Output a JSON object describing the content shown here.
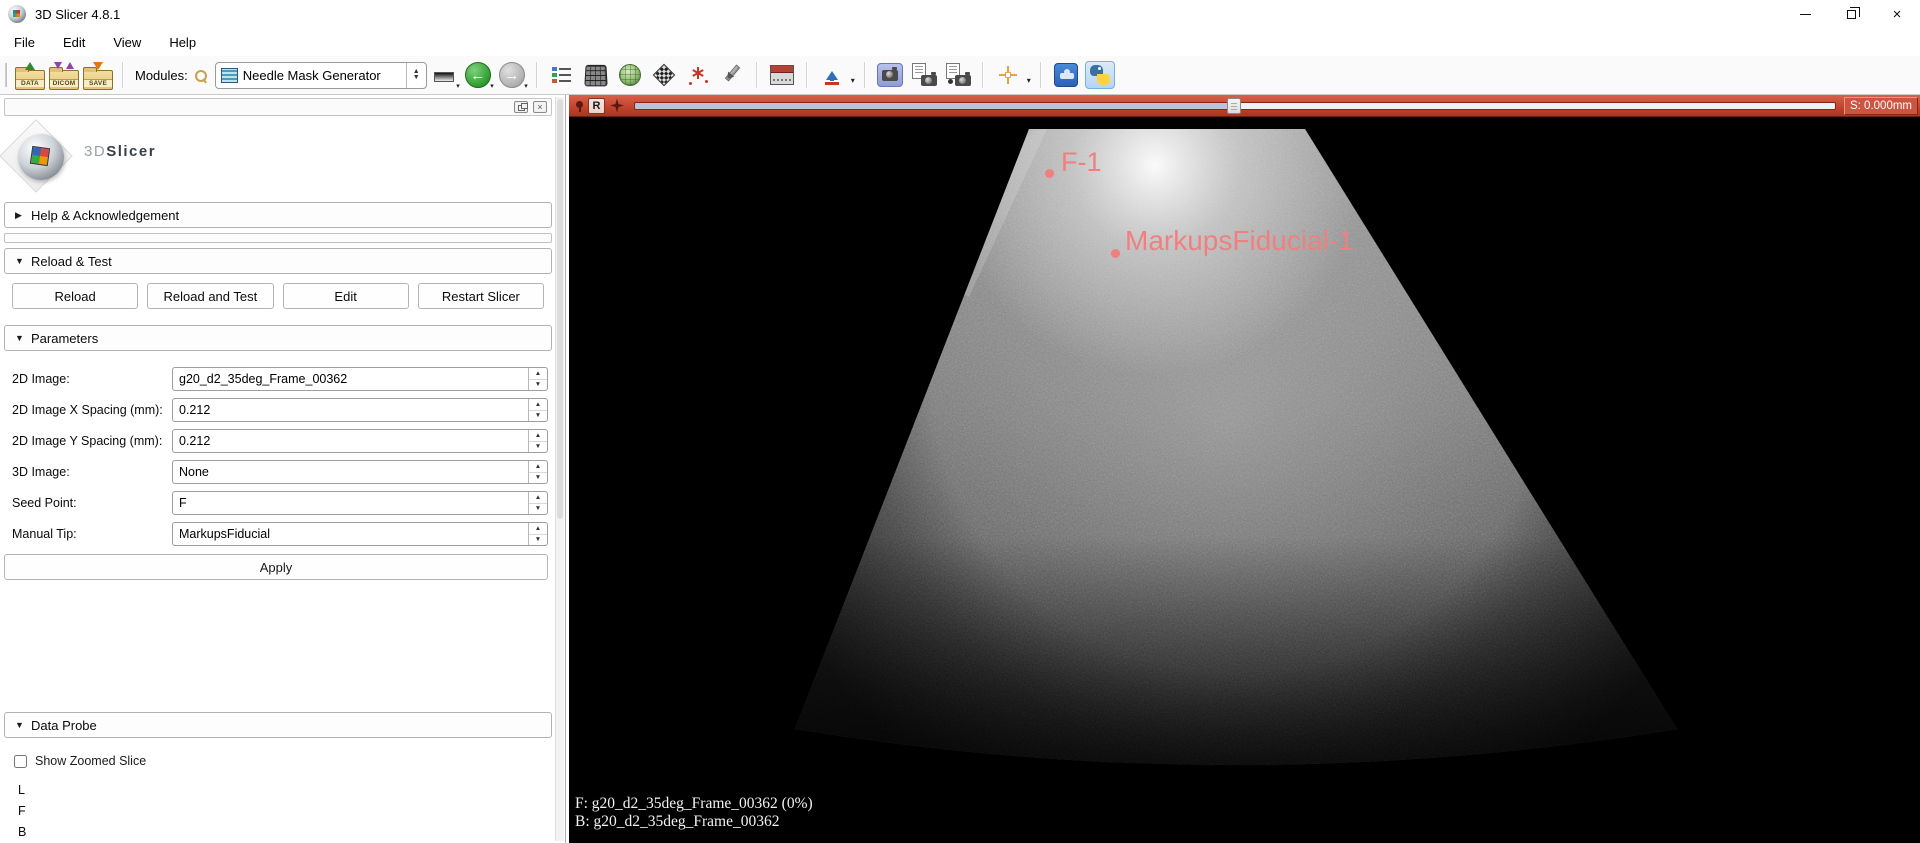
{
  "window": {
    "title": "3D Slicer 4.8.1"
  },
  "menu": {
    "items": [
      "File",
      "Edit",
      "View",
      "Help"
    ]
  },
  "toolbar": {
    "data_label": "DATA",
    "dicom_label": "DICOM",
    "save_label": "SAVE",
    "modules_label": "Modules:",
    "module_selected": "Needle Mask Generator"
  },
  "panel": {
    "logo_prefix": "3D",
    "logo_name": "Slicer",
    "help_header": "Help & Acknowledgement",
    "reload_header": "Reload & Test",
    "reload_buttons": [
      "Reload",
      "Reload and Test",
      "Edit",
      "Restart Slicer"
    ],
    "parameters_header": "Parameters",
    "fields": [
      {
        "label": "2D Image:",
        "value": "g20_d2_35deg_Frame_00362"
      },
      {
        "label": "2D Image X Spacing (mm):",
        "value": "0.212"
      },
      {
        "label": "2D Image Y Spacing (mm):",
        "value": "0.212"
      },
      {
        "label": "3D Image:",
        "value": "None"
      },
      {
        "label": "Seed Point:",
        "value": "F"
      },
      {
        "label": "Manual Tip:",
        "value": "MarkupsFiducial"
      }
    ],
    "apply_label": "Apply",
    "dataprobe_header": "Data Probe",
    "show_zoomed_label": "Show Zoomed Slice",
    "axis_rows": [
      "L",
      "F",
      "B"
    ]
  },
  "slice_view": {
    "orientation_label": "R",
    "offset_label": "S: 0.000mm",
    "fiducials": [
      {
        "label": "F-1"
      },
      {
        "label": "MarkupsFiducial-1"
      }
    ],
    "corner_line1": "F: g20_d2_35deg_Frame_00362 (0%)",
    "corner_line2": "B: g20_d2_35deg_Frame_00362",
    "colors": {
      "bar": "#c2452f",
      "fiducial": "#f08080"
    }
  },
  "icons": {
    "collapsed": "▶",
    "expanded": "▼",
    "spin_up": "▲",
    "spin_down": "▼",
    "close": "×",
    "dropdown": "▾",
    "back_arrow": "←",
    "forward_arrow": "→"
  }
}
